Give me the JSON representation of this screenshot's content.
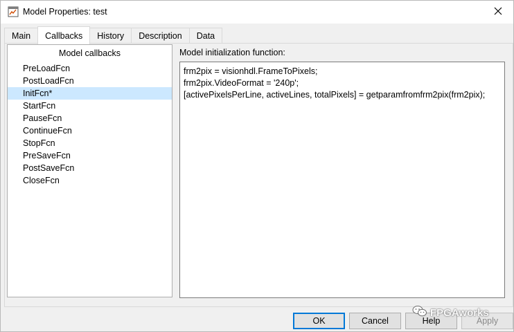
{
  "window": {
    "title": "Model Properties: test",
    "icon": "simulink-model-icon",
    "close_icon": "close-icon"
  },
  "tabs": [
    {
      "label": "Main",
      "active": false
    },
    {
      "label": "Callbacks",
      "active": true
    },
    {
      "label": "History",
      "active": false
    },
    {
      "label": "Description",
      "active": false
    },
    {
      "label": "Data",
      "active": false
    }
  ],
  "callbacks": {
    "header": "Model callbacks",
    "items": [
      {
        "label": "PreLoadFcn"
      },
      {
        "label": "PostLoadFcn"
      },
      {
        "label": "InitFcn*",
        "selected": true
      },
      {
        "label": "StartFcn"
      },
      {
        "label": "PauseFcn"
      },
      {
        "label": "ContinueFcn"
      },
      {
        "label": "StopFcn"
      },
      {
        "label": "PreSaveFcn"
      },
      {
        "label": "PostSaveFcn"
      },
      {
        "label": "CloseFcn"
      }
    ]
  },
  "editor": {
    "label": "Model initialization function:",
    "lines": [
      "frm2pix = visionhdl.FrameToPixels;",
      "frm2pix.VideoFormat = '240p';",
      "[activePixelsPerLine, activeLines, totalPixels] = getparamfromfrm2pix(frm2pix);"
    ]
  },
  "buttons": {
    "ok": "OK",
    "cancel": "Cancel",
    "help": "Help",
    "apply": "Apply"
  },
  "watermark": {
    "text": "FPGAworks",
    "icon": "wechat-icon"
  },
  "colors": {
    "selection": "#cce8ff",
    "default_button_border": "#0078d7"
  }
}
